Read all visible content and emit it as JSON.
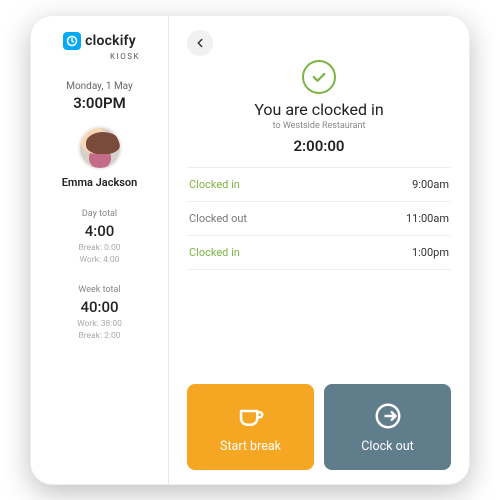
{
  "brand": {
    "name": "clockify",
    "sub": "KIOSK"
  },
  "sidebar": {
    "date": "Monday, 1 May",
    "time": "3:00PM",
    "user_name": "Emma Jackson",
    "day": {
      "label": "Day total",
      "value": "4:00",
      "break": "Break: 0:00",
      "work": "Work: 4:00"
    },
    "week": {
      "label": "Week total",
      "value": "40:00",
      "work": "Work: 38:00",
      "break": "Break: 2:00"
    }
  },
  "status": {
    "title": "You are clocked in",
    "location_prefix": "to",
    "location": "Westside Restaurant",
    "elapsed": "2:00:00"
  },
  "log": [
    {
      "label": "Clocked in",
      "kind": "in",
      "time": "9:00am"
    },
    {
      "label": "Clocked out",
      "kind": "out",
      "time": "11:00am"
    },
    {
      "label": "Clocked in",
      "kind": "in",
      "time": "1:00pm"
    }
  ],
  "actions": {
    "break": "Start break",
    "clockout": "Clock out"
  }
}
